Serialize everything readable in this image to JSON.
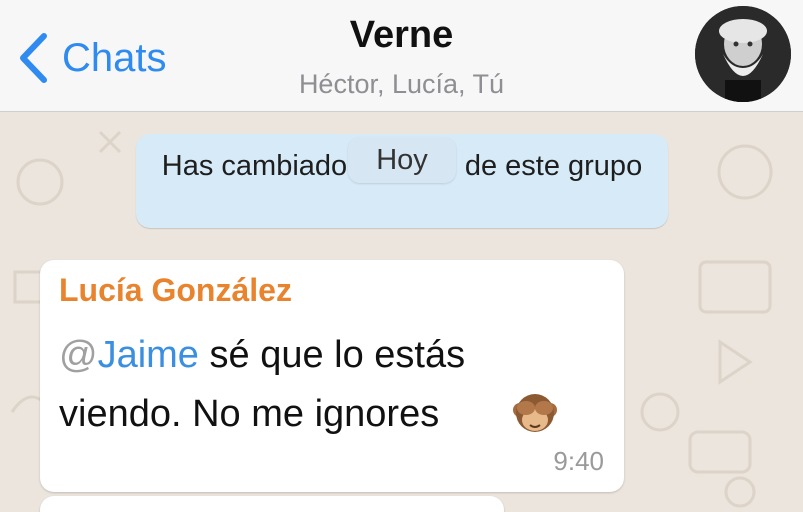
{
  "header": {
    "back_label": "Chats",
    "title": "Verne",
    "subtitle": "Héctor, Lucía, Tú"
  },
  "chat": {
    "system_message": "Has cambiado el ícono de este grupo",
    "date_label": "Hoy"
  },
  "message": {
    "sender": "Lucía González",
    "mention_at": "@",
    "mention_name": "Jaime",
    "line1_rest": " sé que lo estás",
    "line2": "viendo. No me ignores",
    "time": "9:40",
    "emoji": "see-no-evil-monkey"
  },
  "colors": {
    "accent": "#2f8bf0",
    "sender_name": "#e8832e",
    "chat_background": "#ece5dd",
    "system_bubble": "#d6eaf8"
  }
}
